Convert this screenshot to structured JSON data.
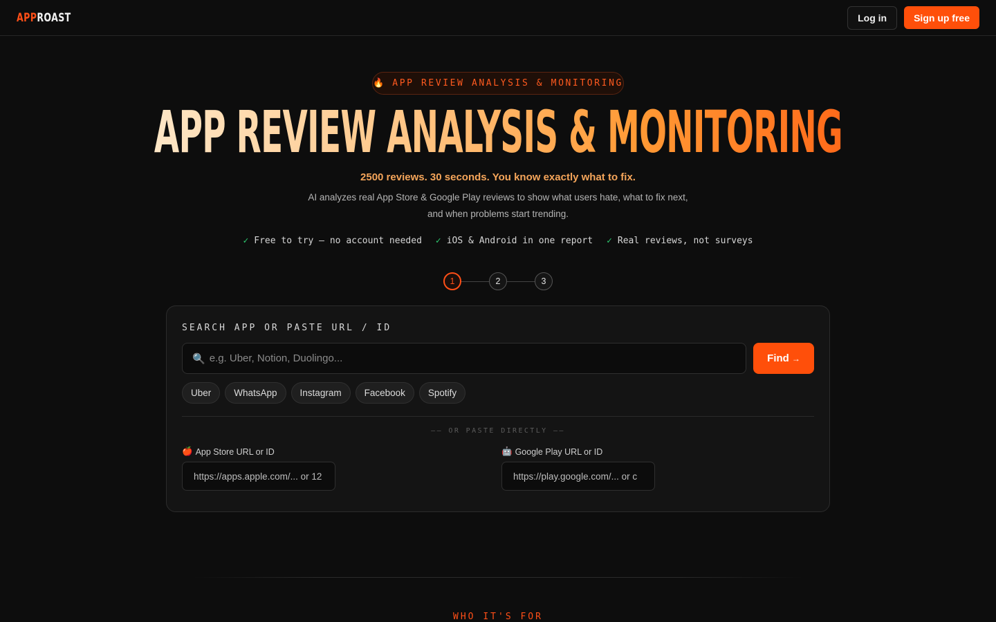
{
  "header": {
    "logo_part1": "APP",
    "logo_part2": "ROAST",
    "login_label": "Log in",
    "signup_label": "Sign up free"
  },
  "hero": {
    "badge_icon": "fire-icon",
    "badge_emoji": "🔥",
    "badge_text": "APP REVIEW ANALYSIS & MONITORING",
    "title": "APP REVIEW ANALYSIS & MONITORING",
    "tagline": "2500 reviews. 30 seconds. You know exactly what to fix.",
    "description": "AI analyzes real App Store & Google Play reviews to show what users hate, what to fix next, and when problems start trending.",
    "checks": [
      {
        "mark": "✓",
        "text": "Free to try — no account needed"
      },
      {
        "mark": "✓",
        "text": "iOS & Android in one report"
      },
      {
        "mark": "✓",
        "text": "Real reviews, not surveys"
      }
    ]
  },
  "steps": {
    "items": [
      "1",
      "2",
      "3"
    ],
    "active": 1
  },
  "search_card": {
    "label": "SEARCH APP OR PASTE URL / ID",
    "search_icon": "🔍",
    "search_placeholder": "e.g. Uber, Notion, Duolingo...",
    "search_value": "",
    "find_label": "Find",
    "find_arrow": "→",
    "suggestions": [
      "Uber",
      "WhatsApp",
      "Instagram",
      "Facebook",
      "Spotify"
    ],
    "or_paste_text": "—— OR PASTE DIRECTLY ——",
    "app_store": {
      "icon": "🍎",
      "label": "App Store URL or ID",
      "placeholder": "https://apps.apple.com/... or 12",
      "value": ""
    },
    "google_play": {
      "icon": "🤖",
      "label": "Google Play URL or ID",
      "placeholder": "https://play.google.com/... or c",
      "value": ""
    }
  },
  "next_section": {
    "eyebrow": "WHO IT'S FOR"
  },
  "colors": {
    "accent": "#ff4f0a",
    "background": "#0d0d0d",
    "card": "#141414",
    "tagline": "#f5a55a",
    "check": "#2ecc71"
  }
}
